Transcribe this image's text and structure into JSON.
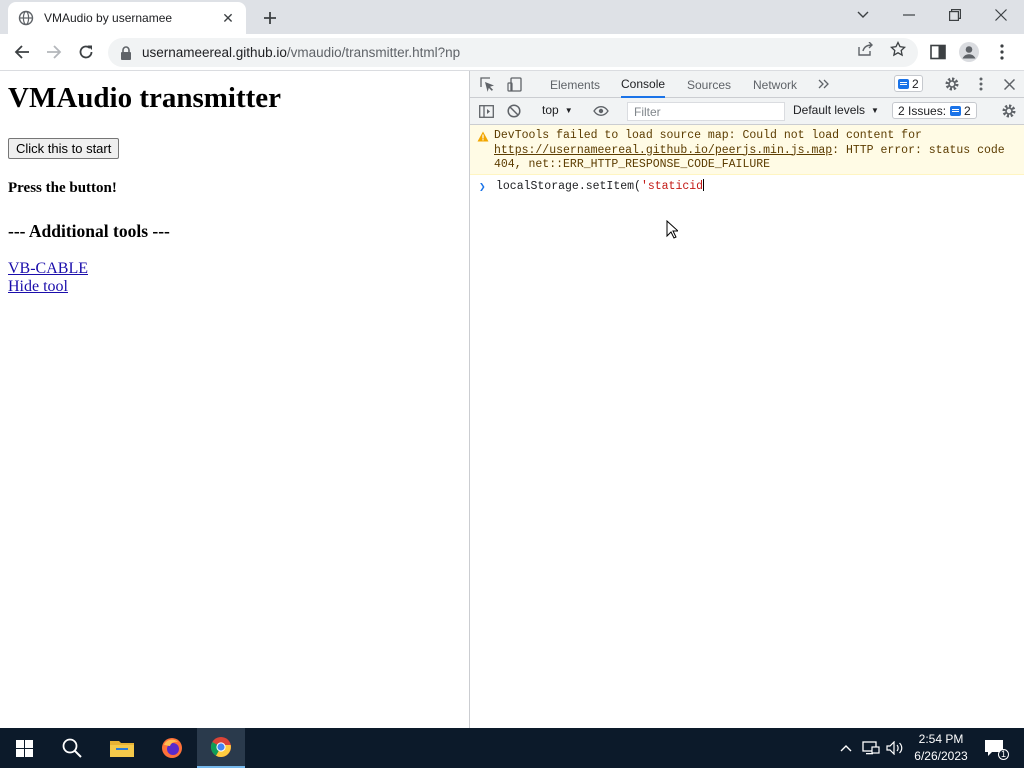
{
  "browser": {
    "tab_title": "VMAudio by usernamee",
    "url_host": "usernameereal.github.io",
    "url_path": "/vmaudio/transmitter.html?np"
  },
  "page": {
    "heading": "VMAudio transmitter",
    "start_button": "Click this to start",
    "status": "Press the button!",
    "tools_heading": "--- Additional tools ---",
    "links": [
      "VB-CABLE",
      "Hide tool"
    ]
  },
  "devtools": {
    "tabs": [
      "Elements",
      "Console",
      "Sources",
      "Network"
    ],
    "active_tab": "Console",
    "messages_count": "2",
    "context": "top",
    "filter_placeholder": "Filter",
    "levels": "Default levels",
    "issues_label": "2 Issues:",
    "issues_count": "2",
    "warning": {
      "text_before": "DevTools failed to load source map: Could not load content for ",
      "link": "https://usernameereal.github.io/peerjs.min.js.map",
      "text_after": ": HTTP error: status code 404, net::ERR_HTTP_RESPONSE_CODE_FAILURE"
    },
    "console_input_code": "localStorage.setItem(",
    "console_input_string": "'staticid"
  },
  "taskbar": {
    "time": "2:54 PM",
    "date": "6/26/2023",
    "notification_count": "1"
  }
}
